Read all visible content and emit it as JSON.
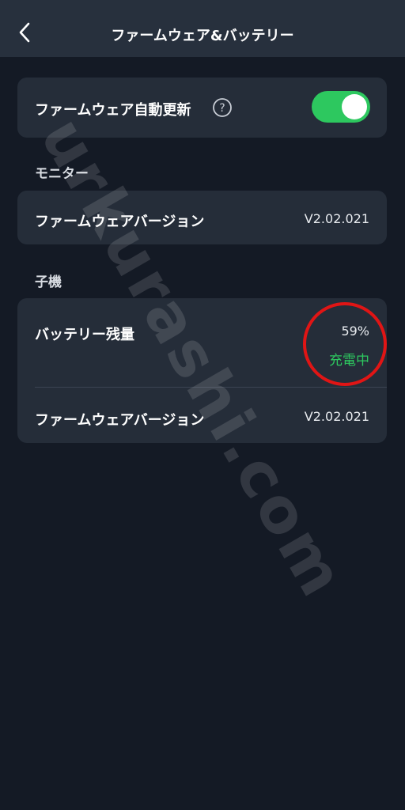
{
  "header": {
    "title": "ファームウェア&バッテリー",
    "back_icon": "chevron-left-icon"
  },
  "auto_update": {
    "label": "ファームウェア自動更新",
    "help_icon": "question-circle-icon",
    "enabled": true
  },
  "monitor": {
    "section_label": "モニター",
    "firmware_label": "ファームウェアバージョン",
    "firmware_value": "V2.02.021"
  },
  "child": {
    "section_label": "子機",
    "battery_label": "バッテリー残量",
    "battery_value": "59%",
    "battery_status": "充電中",
    "firmware_label": "ファームウェアバージョン",
    "firmware_value": "V2.02.021"
  },
  "watermark": {
    "text": "urkurashi.com"
  },
  "colors": {
    "background": "#141a25",
    "header": "#27303d",
    "card": "#252d39",
    "toggle_on": "#2dc85f",
    "status_green": "#2dc85f",
    "highlight_circle": "#e01515"
  }
}
